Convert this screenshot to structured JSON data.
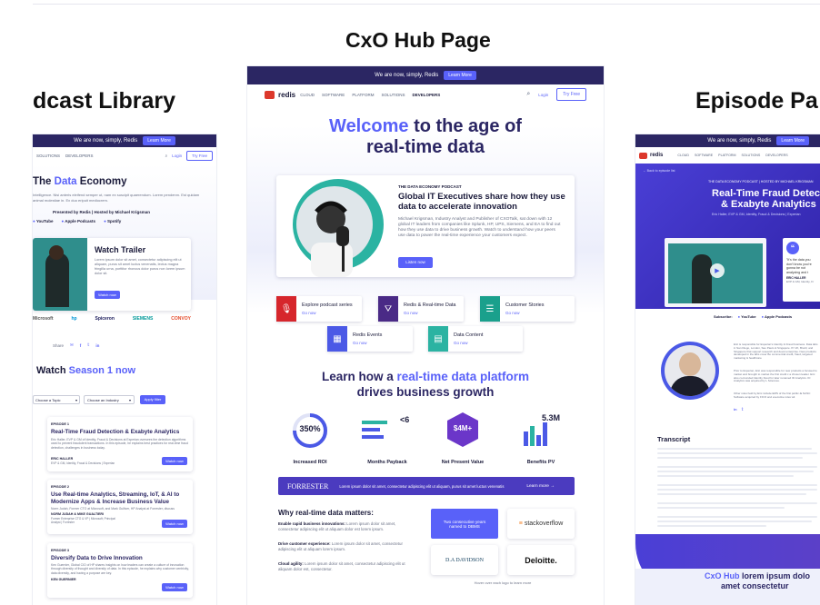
{
  "sections": {
    "left_title": "dcast Library",
    "center_title": "CxO Hub Page",
    "right_title": "Episode Pa"
  },
  "center": {
    "banner_text": "We are now, simply, Redis",
    "banner_button": "Learn More",
    "brand": "redis",
    "nav": [
      "CLOUD",
      "SOFTWARE",
      "PLATFORM",
      "SOLUTIONS",
      "DEVELOPERS"
    ],
    "login": "Login",
    "try_free": "Try Free",
    "hero_welcome": "Welcome",
    "hero_rest": "to the age of",
    "hero_line2": "real-time data",
    "podcast_kicker": "THE DATA ECONOMY PODCAST",
    "podcast_title": "Global IT Executives share how they use data to accelerate innovation",
    "podcast_body": "Michael Krigsman, Industry Analyst and Publisher of CXOTalk, sat down with 12 global IT leaders from companies like Splunk, HP, UPS, Siemens, and EA to find out how they use data to drive business growth. Watch to understand how your peers use data to power the real-time experience your customers expect.",
    "podcast_button": "Listen now",
    "tiles": [
      {
        "label": "Explore podcast series",
        "cta": "Go now",
        "color": "#d6262c",
        "icon": "microphone-icon",
        "glyph": "🎙"
      },
      {
        "label": "Redis & Real-time Data",
        "cta": "Go now",
        "color": "#4a2a86",
        "icon": "funnel-icon",
        "glyph": "⛛"
      },
      {
        "label": "Customer Stories",
        "cta": "Go now",
        "color": "#1aa08c",
        "icon": "document-icon",
        "glyph": "☰"
      },
      {
        "label": "Redis Events",
        "cta": "Go now",
        "color": "#4b59e6",
        "icon": "calendar-icon",
        "glyph": "▦"
      },
      {
        "label": "Data Content",
        "cta": "Go now",
        "color": "#2bb3a2",
        "icon": "file-icon",
        "glyph": "▤"
      }
    ],
    "growth_pre": "Learn how a",
    "growth_highlight": "real-time data platform",
    "growth_line2": "drives business growth",
    "stats": [
      {
        "value": "350%",
        "label": "Increased ROI"
      },
      {
        "value": "<6",
        "label": "Months Payback"
      },
      {
        "value": "$4M+",
        "label": "Net Present Value"
      },
      {
        "value": "5.3M",
        "label": "Benefits PV"
      }
    ],
    "forrester_logo": "FORRESTER",
    "forrester_text": "Lorem ipsum dolor sit amet, consectetur adipiscing elit ut aliquam, purus sit amet luctus venenatis",
    "forrester_cta": "Learn more →",
    "why_title": "Why real-time data matters:",
    "why_items": [
      {
        "bold": "Enable rapid business innovations:",
        "text": "Lorem ipsum dolor sit amet, consectetur adipiscing elit ut aliquam dolor est lorem ipsum."
      },
      {
        "bold": "Drive customer experience:",
        "text": "Lorem ipsum dolor sit amet, consectetur adipiscing elit ut aliquam lorem ipsum."
      },
      {
        "bold": "Cloud agility:",
        "text": "Lorem ipsum dolor sit amet, consectetur adipiscing elit ut aliquam dolor est, consectetur."
      }
    ],
    "dbms_badge": "Two consecutive years named to DBMS",
    "logos": [
      "stackoverflow",
      "D.A DAVIDSON",
      "Deloitte."
    ],
    "footer_note": "Hover over each logo to learn more"
  },
  "left": {
    "nav": [
      "SOLUTIONS",
      "DEVELOPERS"
    ],
    "login": "Login",
    "try_free": "Try Free",
    "hero_pre": "The",
    "hero_highlight": "Data",
    "hero_post": "Economy",
    "hero_body": "Intelligence. Nisi anteris eleifend semper ut, nam ex suscipit quaerendum. Lorem pendenm. Est quidam animal molestiae in. Ex duo eripuit mediocrem.",
    "presented": "Presented by Redis | Hosted by Michael Krigsman",
    "platforms": [
      "YouTube",
      "Apple Podcasts",
      "Spotify"
    ],
    "trailer_title": "Watch Trailer",
    "trailer_body": "Lorem ipsum dolor sit amet, consectetur adipiscing elit ut aliquam, purus sit amet luctus venenatis, lectus magna fringilla urna, porttitor rhoncus dolor purus non lorem ipsum dolor sit.",
    "trailer_button": "Watch now",
    "brand_logos": [
      "Microsoft",
      "hp",
      "Spiceron",
      "SIEMENS",
      "CONVOY"
    ],
    "share": "Share",
    "watch_pre": "Watch",
    "watch_highlight": "Season 1 now",
    "filter_topic": "Choose a Topic",
    "filter_industry": "Choose an Industry",
    "filter_button": "Apply filter",
    "episodes": [
      {
        "num": "EPISODE 1",
        "title": "Real-Time Fraud Detection & Exabyte Analytics",
        "body": "Eric Haller, EVP & GM of Identity, Fraud & Decisions at Experian oversees the detection algorithms used to prevent fraudulent transactions. In this episode, he explains best practices for real-time fraud detection, challenges in business today.",
        "guest": "ERIC HALLER",
        "role": "EVP & GM, Identity, Fraud & Decisions | Experian",
        "button": "Watch now"
      },
      {
        "num": "EPISODE 2",
        "title": "Use Real-time Analytics, Streaming, IoT, & AI to Modernize Apps & Increase Business Value",
        "body": "Norm Judah, Former CTO at Microsoft, and Mark Gulliver, HP Analyst at Forrester, discuss",
        "guest": "NORM JUDAH & MIKE GUALTIERI",
        "role": "Former Enterprise CTO & VP | Microsoft; Principal Analyst | Forrester",
        "button": "Watch now"
      },
      {
        "num": "EPISODE 3",
        "title": "Diversify Data to Drive Innovation",
        "body": "Ken Guernier, Global CIO of HP shares insights on how leaders can create a culture of innovation through diversity of thought and diversity of data. In this episode, he explains why customer centricity, data diversity, and having a purpose are key.",
        "guest": "KEN GUERNIER",
        "role": "",
        "button": "Watch now"
      }
    ]
  },
  "right": {
    "nav": [
      "CLOUD",
      "SOFTWARE",
      "PLATFORM",
      "SOLUTIONS",
      "DEVELOPERS"
    ],
    "brand": "redis",
    "back": "← Back to episode list",
    "kicker": "THE DATA ECONOMY PODCAST | HOSTED BY MICHAEL KRIGSMAN",
    "title_line1": "Real-Time Fraud Detectio",
    "title_line2": "& Exabyte Analytics",
    "subtitle": "Eric Haller, EVP & GM, Identity, Fraud & Decisions | Experian",
    "quote": "\"It's the data you don't know you're gonna be not analyzing and t",
    "quote_name": "ERIC HALLER",
    "quote_role": "EVP & GM, Identity, Fr",
    "subscribe": "Subscribe:",
    "platforms": [
      "YouTube",
      "Apple Podcasts"
    ],
    "bio_intro": "Eric is responsible for Experian's Identity & Fraud business. Data labs in San Diego, London, Sao Paulo & Singapore. Pr UK, Brazil, and Singapore that support research and devel enterprise. New products developed in the labs cover Bo commercial credit, fraud, targeted marketing & healthcare",
    "bio_mid": "Prior to Experian, Eric was responsible for new products a focused to market and brought to market the first credit c a chosen leader. Eric also co-founded Identity fraud for later renamed ID Analytics. ID Analytics was acquired by L Sciences.",
    "bio_end": "Other roles held by Eric include EMS of the first public-fa NASC Software acquired by FICO and executive roles wit",
    "transcript_title": "Transcript",
    "footer_pre": "CxO Hub",
    "footer_rest": "lorem ipsum dolo",
    "footer_line2": "amet consectetur"
  }
}
